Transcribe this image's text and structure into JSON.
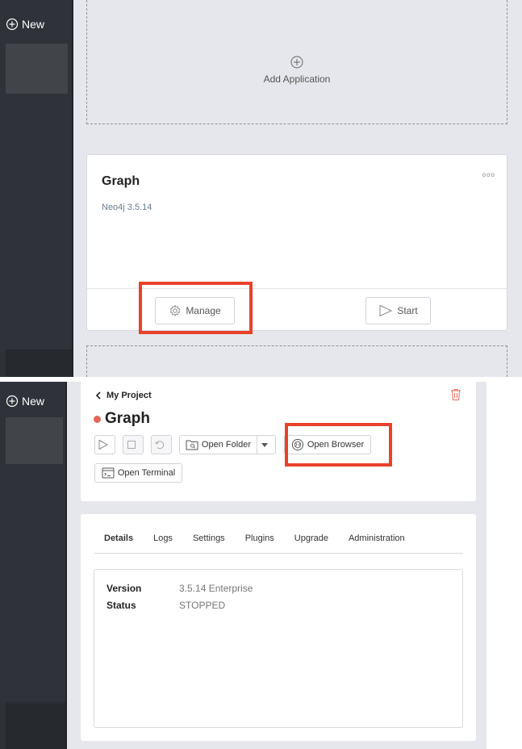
{
  "sidebar": {
    "new_label": "New"
  },
  "add_application": {
    "label": "Add Application"
  },
  "app_card": {
    "title": "Graph",
    "subtitle": "Neo4j 3.5.14",
    "more_label": "ooo",
    "manage_label": "Manage",
    "start_label": "Start"
  },
  "project": {
    "breadcrumb": "My Project",
    "title": "Graph",
    "status_color": "#e3685b",
    "open_folder_label": "Open Folder",
    "open_browser_label": "Open Browser",
    "open_terminal_label": "Open Terminal"
  },
  "tabs": [
    "Details",
    "Logs",
    "Settings",
    "Plugins",
    "Upgrade",
    "Administration"
  ],
  "details": {
    "version_key": "Version",
    "version_value": "3.5.14 Enterprise",
    "status_key": "Status",
    "status_value": "STOPPED"
  },
  "highlight_color": "#e8422b",
  "icons": [
    "plus-circle-icon",
    "gear-icon",
    "play-icon",
    "stop-icon",
    "undo-icon",
    "folder-icon",
    "globe-icon",
    "terminal-icon",
    "trash-icon",
    "chevron-left-icon",
    "caret-down-icon",
    "more-icon"
  ]
}
